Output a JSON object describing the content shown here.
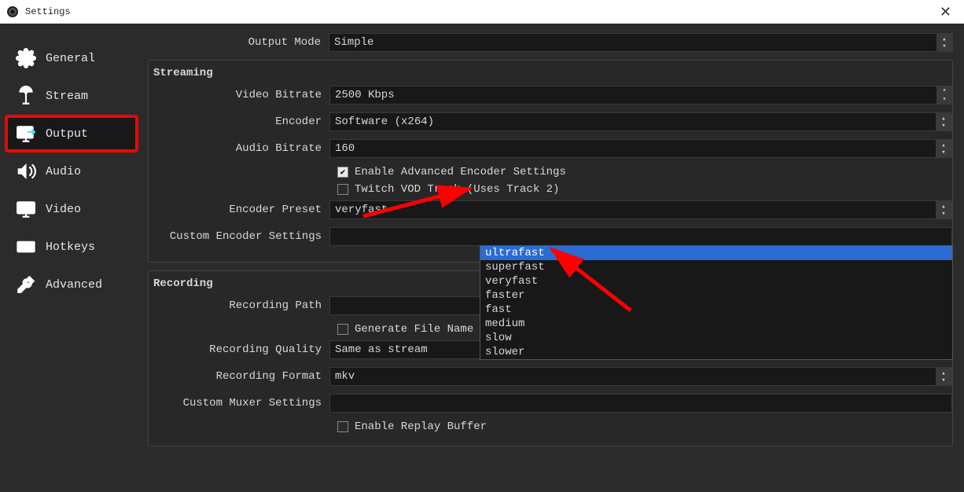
{
  "window": {
    "title": "Settings"
  },
  "sidebar": {
    "items": [
      {
        "label": "General"
      },
      {
        "label": "Stream"
      },
      {
        "label": "Output"
      },
      {
        "label": "Audio"
      },
      {
        "label": "Video"
      },
      {
        "label": "Hotkeys"
      },
      {
        "label": "Advanced"
      }
    ]
  },
  "output_mode": {
    "label": "Output Mode",
    "value": "Simple"
  },
  "streaming": {
    "title": "Streaming",
    "video_bitrate": {
      "label": "Video Bitrate",
      "value": "2500 Kbps"
    },
    "encoder": {
      "label": "Encoder",
      "value": "Software (x264)"
    },
    "audio_bitrate": {
      "label": "Audio Bitrate",
      "value": "160"
    },
    "enable_advanced": {
      "label": "Enable Advanced Encoder Settings",
      "checked": true
    },
    "twitch_vod": {
      "label": "Twitch VOD Track (Uses Track 2)",
      "checked": false
    },
    "encoder_preset": {
      "label": "Encoder Preset",
      "value": "veryfast"
    },
    "custom_encoder": {
      "label": "Custom Encoder Settings",
      "value": ""
    },
    "preset_options": [
      "ultrafast",
      "superfast",
      "veryfast",
      "faster",
      "fast",
      "medium",
      "slow",
      "slower"
    ],
    "preset_highlight": "ultrafast"
  },
  "recording": {
    "title": "Recording",
    "path": {
      "label": "Recording Path",
      "value": ""
    },
    "no_space": {
      "label": "Generate File Name without Space",
      "checked": false
    },
    "quality": {
      "label": "Recording Quality",
      "value": "Same as stream"
    },
    "format": {
      "label": "Recording Format",
      "value": "mkv"
    },
    "muxer": {
      "label": "Custom Muxer Settings",
      "value": ""
    },
    "replay_buffer": {
      "label": "Enable Replay Buffer",
      "checked": false
    }
  }
}
